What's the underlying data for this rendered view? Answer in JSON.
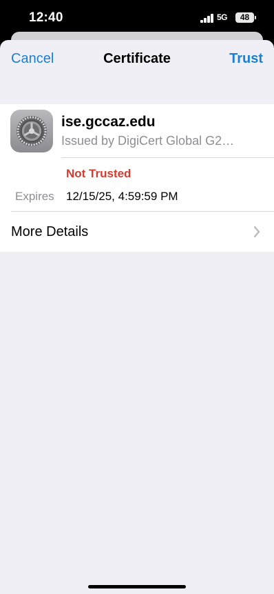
{
  "status_bar": {
    "time": "12:40",
    "network": "5G",
    "battery": "48",
    "signal_icon": "cellular-signal-icon",
    "battery_icon": "battery-icon"
  },
  "navbar": {
    "cancel_label": "Cancel",
    "title": "Certificate",
    "trust_label": "Trust"
  },
  "certificate": {
    "icon": "certificate-gear-icon",
    "host": "ise.gccaz.edu",
    "issuer": "Issued by DigiCert Global G2…",
    "trust_status": "Not Trusted",
    "expires_label": "Expires",
    "expires_value": "12/15/25, 4:59:59 PM"
  },
  "more_details": {
    "label": "More Details",
    "icon": "chevron-right-icon"
  },
  "colors": {
    "accent": "#1a7fd6",
    "warning": "#d93a30",
    "secondary_text": "#8e8e93",
    "sheet_background": "#f0eff5"
  }
}
